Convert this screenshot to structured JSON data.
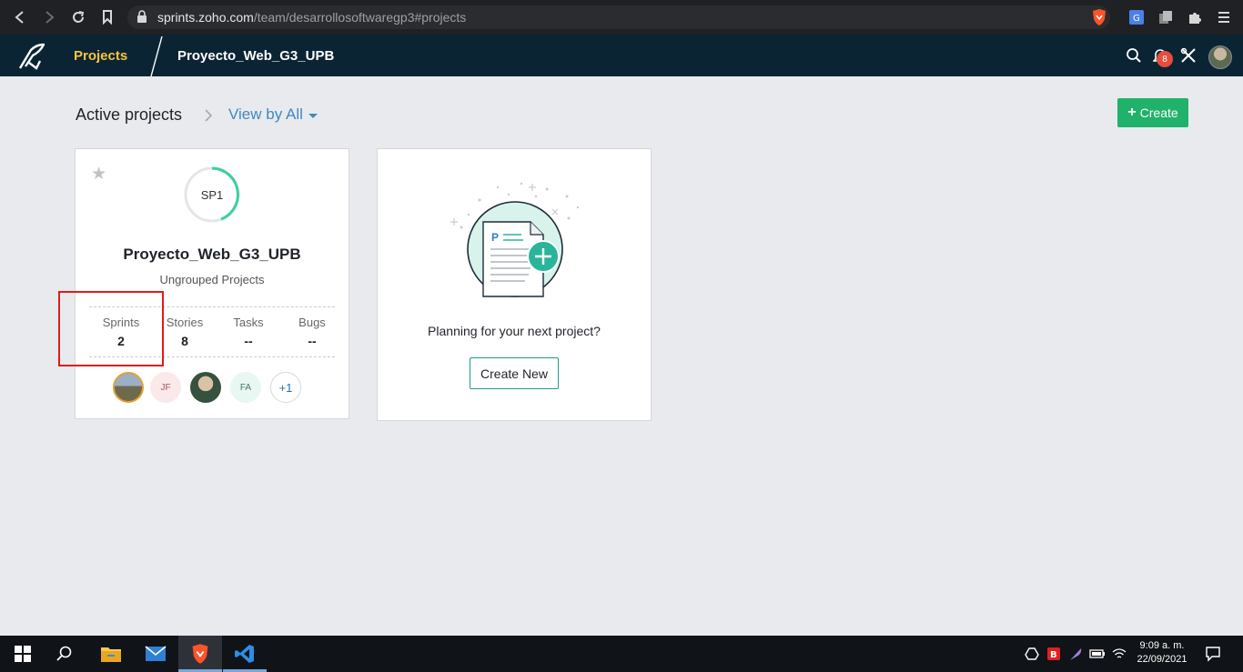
{
  "browser": {
    "url_host": "sprints.zoho.com",
    "url_path": "/team/desarrollosoftwaregp3#projects"
  },
  "header": {
    "app_tab": "Projects",
    "project_title": "Proyecto_Web_G3_UPB",
    "notification_count": "8"
  },
  "main": {
    "section_title": "Active projects",
    "view_by": "View by All",
    "create_label": "Create",
    "project_card": {
      "sprint_badge": "SP1",
      "title": "Proyecto_Web_G3_UPB",
      "group": "Ungrouped Projects",
      "stats": [
        {
          "label": "Sprints",
          "value": "2"
        },
        {
          "label": "Stories",
          "value": "8"
        },
        {
          "label": "Tasks",
          "value": "--"
        },
        {
          "label": "Bugs",
          "value": "--"
        }
      ],
      "members": [
        "JF",
        "FA"
      ],
      "more_members": "+1"
    },
    "new_project_card": {
      "text": "Planning for your next project?",
      "button": "Create New",
      "illustration_letter": "P"
    }
  },
  "taskbar": {
    "time": "9:09 a. m.",
    "date": "22/09/2021"
  },
  "colors": {
    "appbar": "#0b2433",
    "accent_yellow": "#f4c542",
    "create_green": "#20b26b",
    "link_blue": "#3f88c5",
    "highlight_red": "#e01b1b"
  }
}
